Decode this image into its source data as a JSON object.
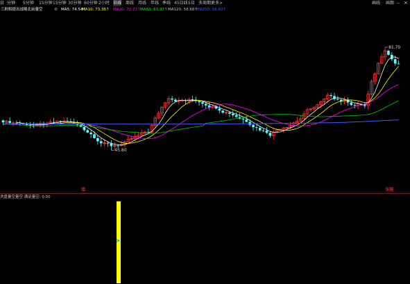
{
  "toolbar": {
    "items": [
      "日",
      "分钟",
      "5分钟",
      "15分钟",
      "15分钟",
      "30分钟",
      "60分钟",
      "2小时",
      "日线",
      "周线",
      "月线",
      "年线",
      "季线",
      "45日线",
      "5日",
      "多周期",
      "更多>"
    ],
    "active_index": 8,
    "right_items": [
      "画线",
      "画图"
    ]
  },
  "ma_legend": {
    "title": "三刷相提出战略北前量空",
    "items": [
      {
        "label": "MA5: 74.54↑",
        "color": "#ffffff"
      },
      {
        "label": "MA10: 73.38↑",
        "color": "#ffff00"
      },
      {
        "label": "MA20: 72.77↑",
        "color": "#ff00ff"
      },
      {
        "label": "MA60: 63.97↑",
        "color": "#00ff00"
      },
      {
        "label": "MA120: 58.68↑",
        "color": "#c0c0c0"
      },
      {
        "label": "MA250: 58.60↑",
        "color": "#3c5cff"
      }
    ]
  },
  "price_labels": {
    "high": "81.70",
    "low": "45.80"
  },
  "event_marks": [
    {
      "label": "增",
      "color": "#ff4040"
    },
    {
      "label": "涨幅",
      "color": "#ff4040"
    }
  ],
  "indicator_legend": "洗盘量空量空 满足量空: 0.00",
  "colors": {
    "up": "#ff3a3a",
    "down": "#54ffff",
    "ma5": "#ffffff",
    "ma10": "#ffff00",
    "ma20": "#ff00ff",
    "ma60": "#00cc00",
    "ma250": "#3c5cff",
    "signal": "#ffff00"
  },
  "chart_data": {
    "type": "candlestick",
    "indicator": {
      "type": "bar",
      "signal_count": 1
    }
  }
}
